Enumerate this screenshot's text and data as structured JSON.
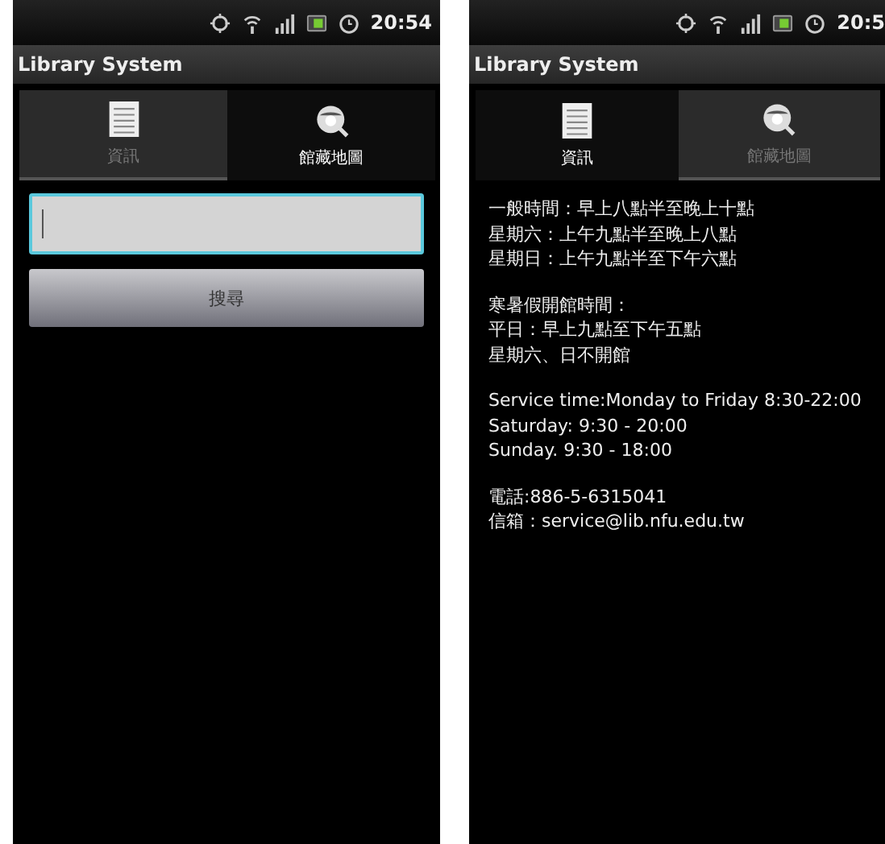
{
  "screens": [
    {
      "kind": "search",
      "status_time": "20:54",
      "title": "Library System",
      "tabs": [
        {
          "label": "資訊",
          "kind": "info",
          "selected": false
        },
        {
          "label": "館藏地圖",
          "kind": "map",
          "selected": true
        }
      ],
      "search": {
        "button": "搜尋",
        "focused": true
      }
    },
    {
      "kind": "info",
      "status_time": "20:5",
      "title": "Library System",
      "tabs": [
        {
          "label": "資訊",
          "kind": "info",
          "selected": true
        },
        {
          "label": "館藏地圖",
          "kind": "map",
          "selected": false
        }
      ],
      "paragraphs": [
        [
          "一般時間：早上八點半至晚上十點",
          "星期六：上午九點半至晚上八點",
          "星期日：上午九點半至下午六點"
        ],
        [
          "寒暑假開館時間：",
          "平日：早上九點至下午五點",
          "星期六、日不開館"
        ],
        [
          "Service time:Monday to Friday 8:30-22:00",
          "Saturday: 9:30 - 20:00",
          "Sunday. 9:30 - 18:00"
        ],
        [
          "電話:886-5-6315041",
          "信箱：service@lib.nfu.edu.tw"
        ]
      ]
    }
  ]
}
